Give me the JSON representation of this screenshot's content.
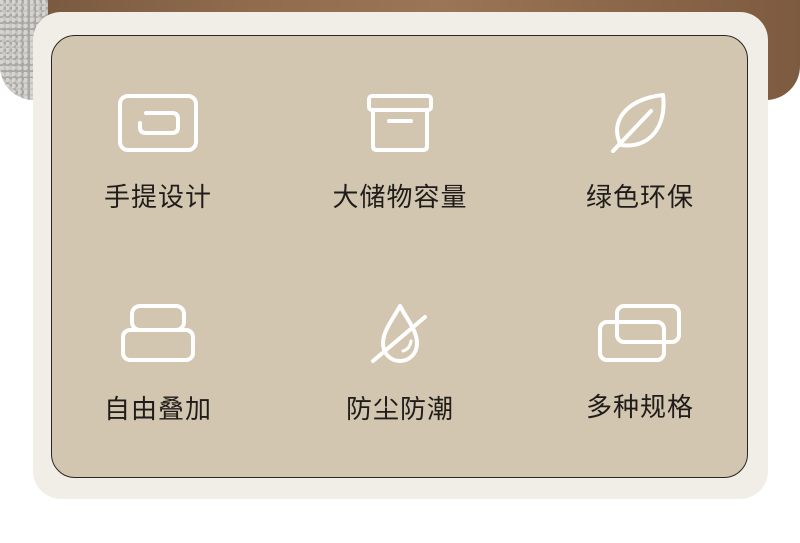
{
  "features": [
    {
      "label": "手提设计",
      "icon": "handle-icon"
    },
    {
      "label": "大储物容量",
      "icon": "storage-box-icon"
    },
    {
      "label": "绿色环保",
      "icon": "leaf-icon"
    },
    {
      "label": "自由叠加",
      "icon": "stack-icon"
    },
    {
      "label": "防尘防潮",
      "icon": "waterproof-drop-icon"
    },
    {
      "label": "多种规格",
      "icon": "multiple-sizes-icon"
    }
  ],
  "colors": {
    "panel": "#d2c6b0",
    "frame": "#f1eee8",
    "text": "#1f1c19",
    "icon": "#ffffff"
  }
}
